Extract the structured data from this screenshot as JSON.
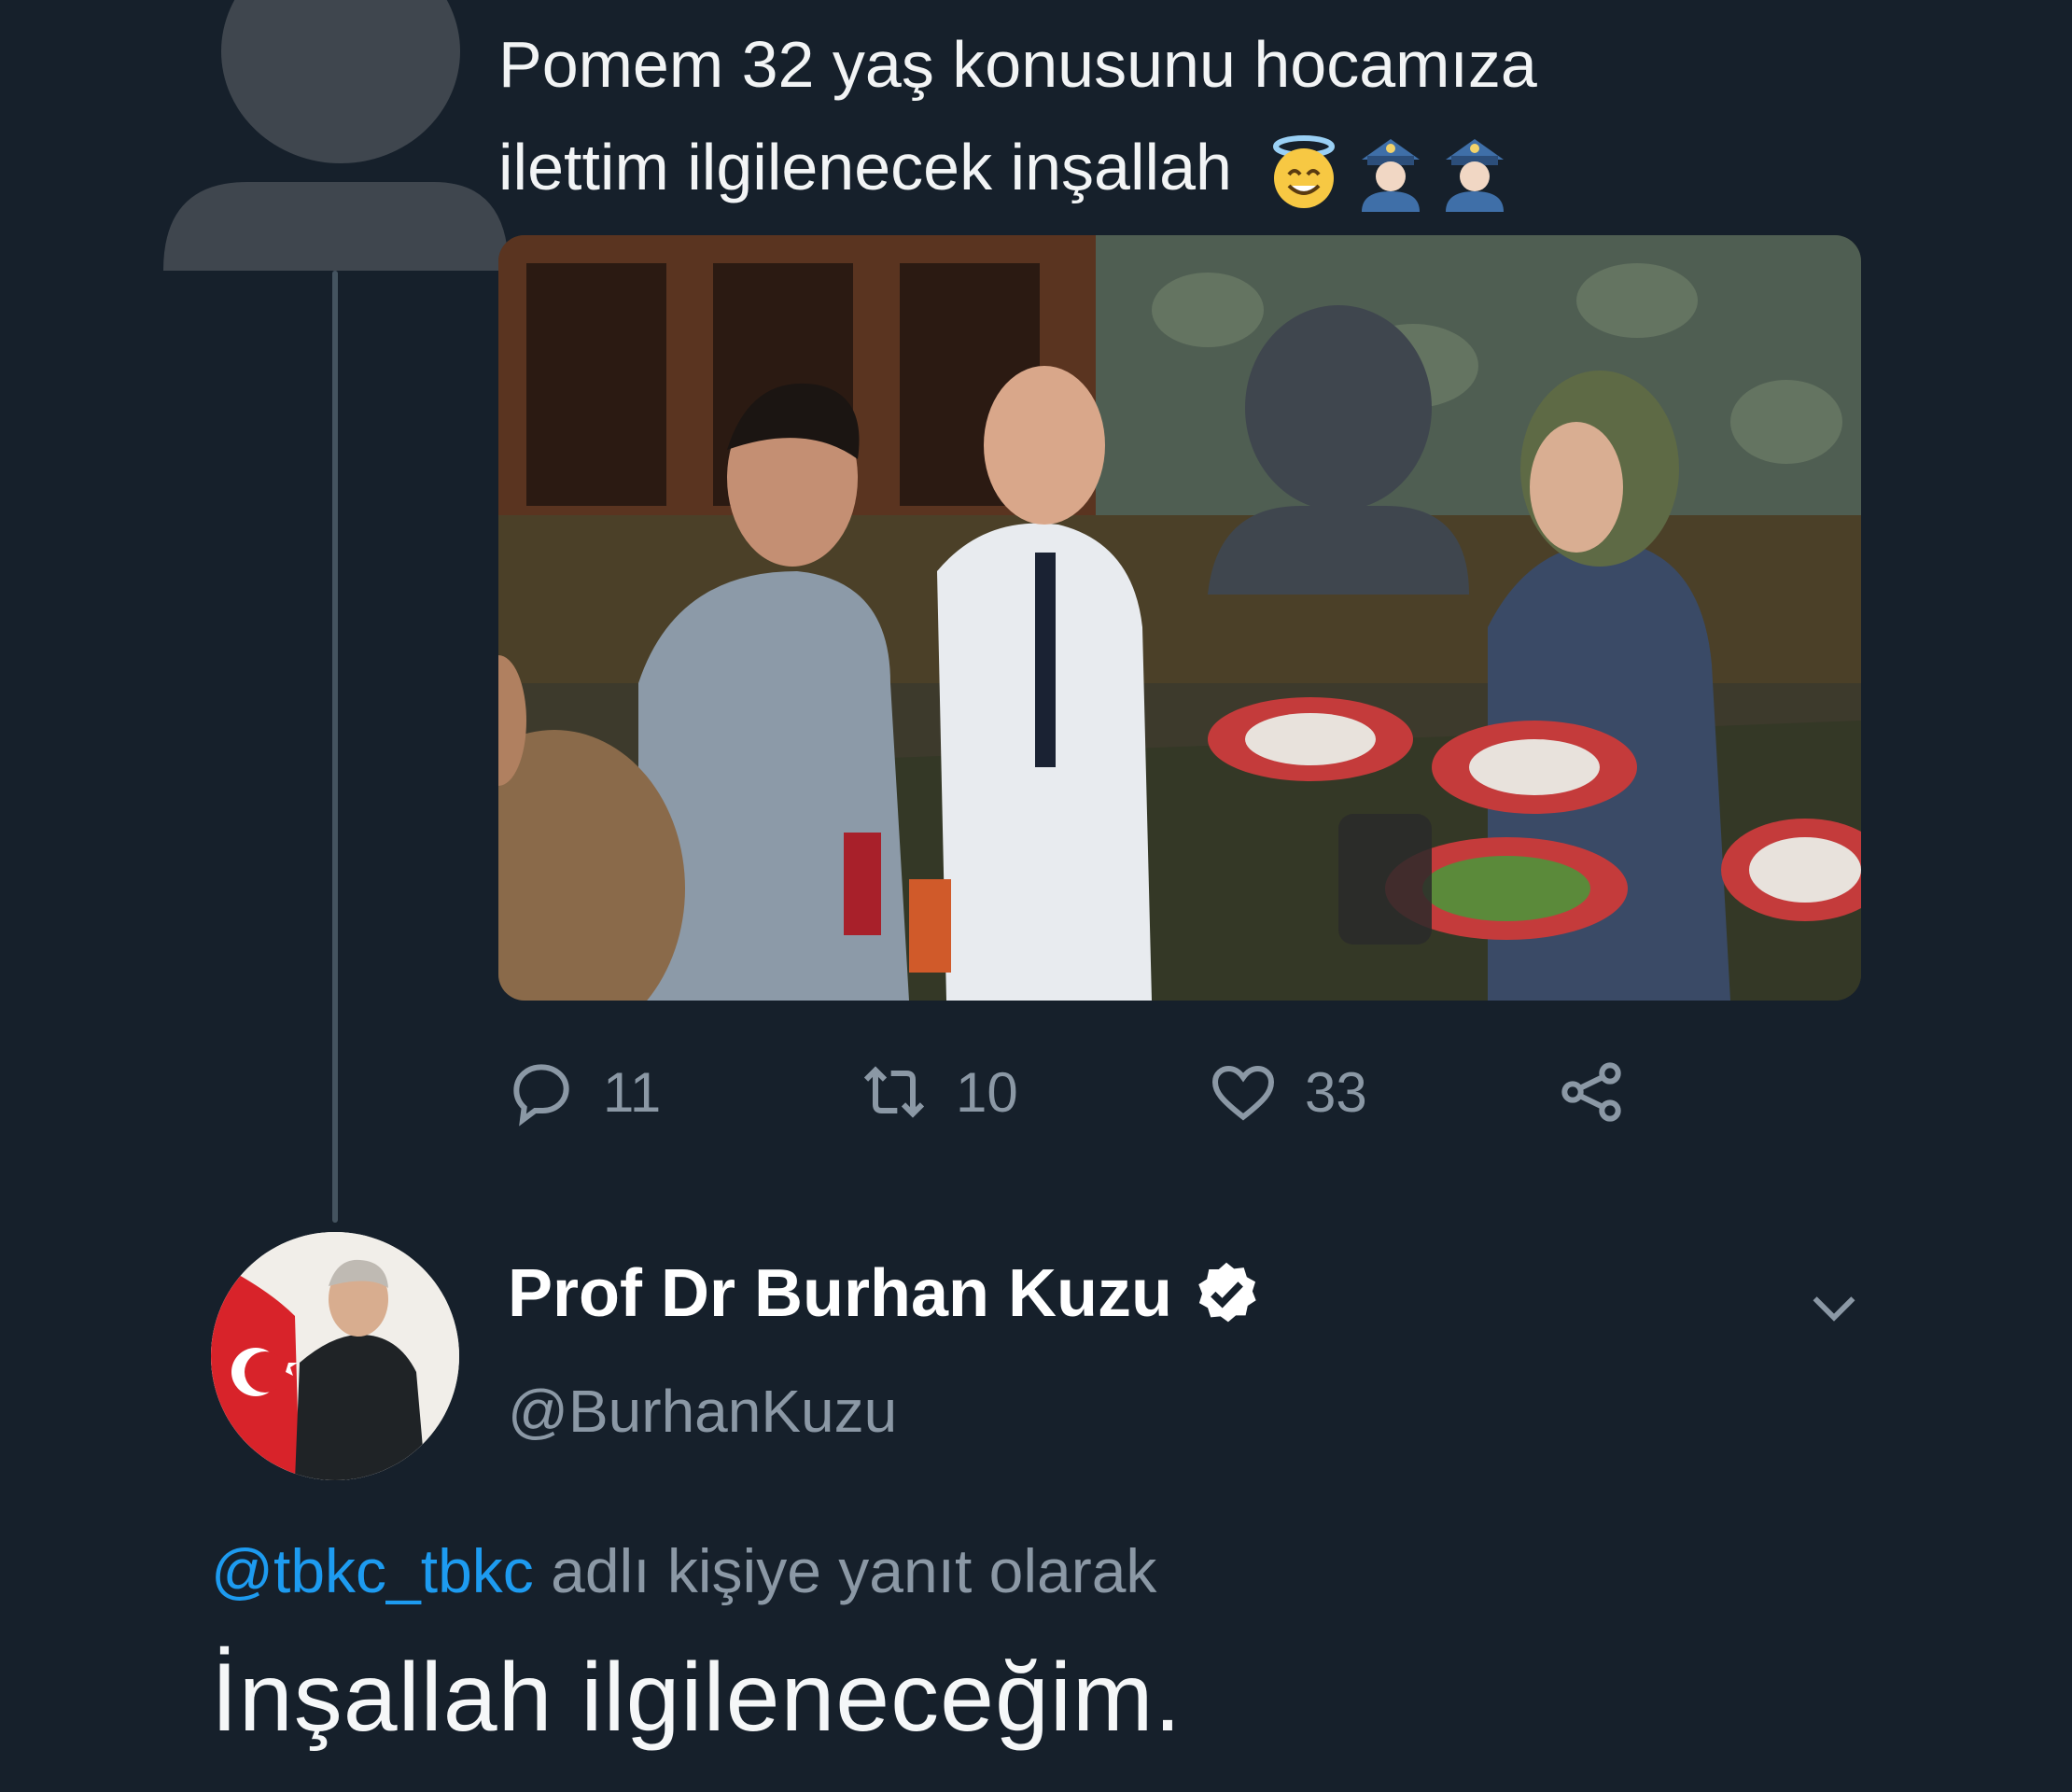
{
  "tweet": {
    "text_line1": "Pomem 32 yaş konusunu hocamıza",
    "text_line2": "ilettim ilgilenecek inşallah",
    "emojis": [
      "smiling-face-with-halo",
      "police-officer",
      "police-officer"
    ],
    "stats": {
      "replies": "11",
      "retweets": "10",
      "likes": "33"
    }
  },
  "reply": {
    "display_name": "Prof Dr Burhan Kuzu",
    "handle": "@BurhanKuzu",
    "verified": true,
    "replying_to_mention": "@tbkc_tbkc",
    "replying_to_suffix": " adlı kişiye yanıt olarak",
    "text": "İnşallah ilgileneceğim."
  },
  "colors": {
    "background": "#16202b",
    "muted": "#8b98a5",
    "link": "#1d9bf0",
    "placeholder": "#3f464e"
  }
}
